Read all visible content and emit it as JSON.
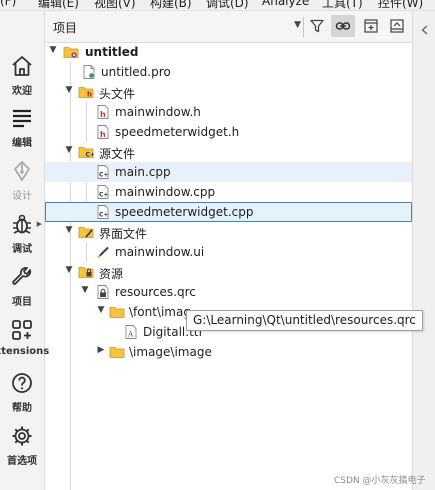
{
  "menubar": {
    "items": [
      "(F)",
      "编辑(E)",
      "视图(V)",
      "构建(B)",
      "调试(D)",
      "Analyze",
      "工具(T)",
      "控件(W)"
    ]
  },
  "modes": [
    {
      "label": "欢迎",
      "icon": "home-icon",
      "enabled": true
    },
    {
      "label": "编辑",
      "icon": "edit-lines-icon",
      "enabled": true
    },
    {
      "label": "设计",
      "icon": "pen-icon",
      "enabled": false
    },
    {
      "label": "调试",
      "icon": "bug-icon",
      "enabled": true
    },
    {
      "label": "项目",
      "icon": "wrench-icon",
      "enabled": true
    },
    {
      "label": "xtensions",
      "icon": "extensions-grid-icon",
      "enabled": true
    },
    {
      "label": "帮助",
      "icon": "help-icon",
      "enabled": true
    },
    {
      "label": "首选项",
      "icon": "gear-icon",
      "enabled": true
    }
  ],
  "toolbar": {
    "view_selector": "项目",
    "buttons": [
      "filter-icon",
      "link-icon",
      "split-add-icon",
      "collapse-icon"
    ]
  },
  "tree": {
    "project": "untitled",
    "project_file": "untitled.pro",
    "headers_group": "头文件",
    "headers": [
      "mainwindow.h",
      "speedmeterwidget.h"
    ],
    "sources_group": "源文件",
    "sources": [
      "main.cpp",
      "mainwindow.cpp",
      "speedmeterwidget.cpp"
    ],
    "forms_group": "界面文件",
    "forms": [
      "mainwindow.ui"
    ],
    "resources_group": "资源",
    "qrc": "resources.qrc",
    "font_prefix": "\\font\\imag",
    "font_file": "Digitall.ttf",
    "image_prefix": "\\image\\image"
  },
  "tooltip": "G:\\Learning\\Qt\\untitled\\resources.qrc",
  "watermark": "CSDN @小灰灰搞电子",
  "colors": {
    "accent": "#3a86c8",
    "folder": "#f5c242",
    "selection": "#e6f2fb"
  }
}
